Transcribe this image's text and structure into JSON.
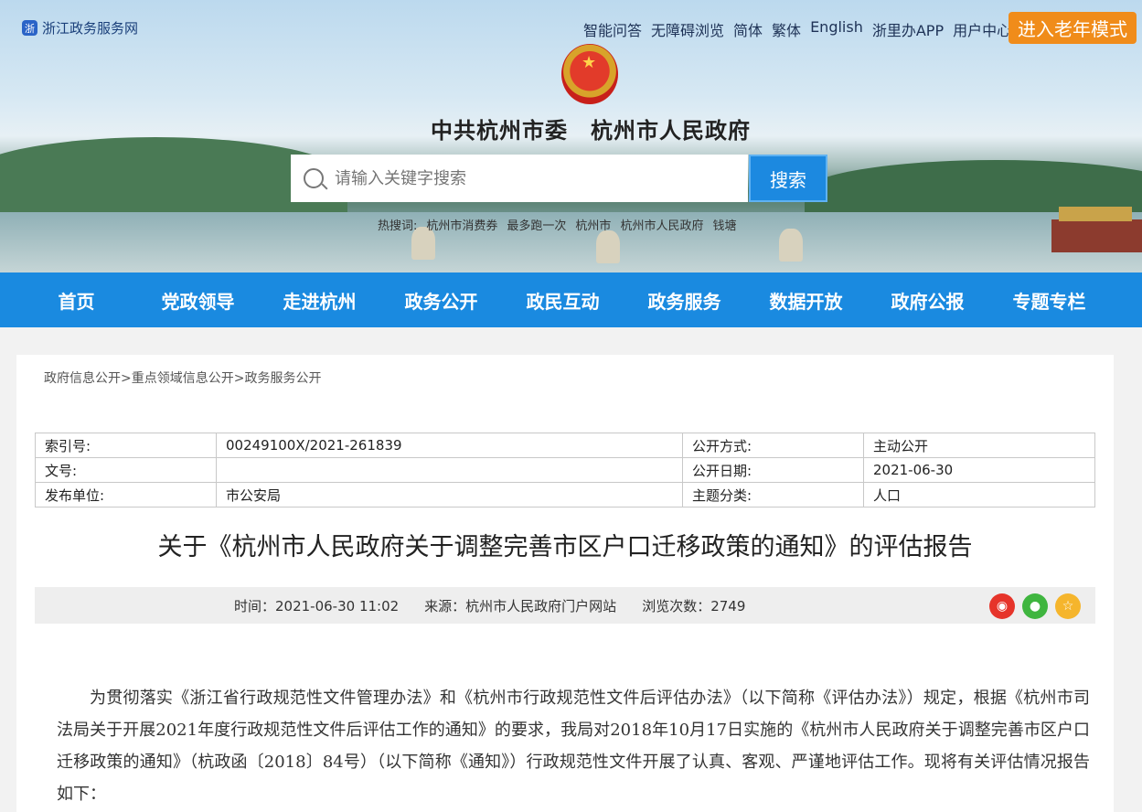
{
  "header": {
    "brand": "浙江政务服务网",
    "toplinks": [
      "智能问答",
      "无障碍浏览",
      "简体",
      "繁体",
      "English",
      "浙里办APP",
      "用户中心"
    ],
    "elder_mode": "进入老年模式",
    "site_title": "中共杭州市委　杭州市人民政府",
    "search": {
      "placeholder": "请输入关键字搜索",
      "button": "搜索"
    },
    "hotwords_label": "热搜词:",
    "hotwords": [
      "杭州市消费券",
      "最多跑一次",
      "杭州市",
      "杭州市人民政府",
      "钱塘"
    ]
  },
  "nav": [
    "首页",
    "党政领导",
    "走进杭州",
    "政务公开",
    "政民互动",
    "政务服务",
    "数据开放",
    "政府公报",
    "专题专栏"
  ],
  "breadcrumb": [
    "政府信息公开",
    ">",
    "重点领域信息公开",
    ">",
    "政务服务公开"
  ],
  "meta": {
    "rows": [
      [
        "索引号:",
        "00249100X/2021-261839",
        "公开方式:",
        "主动公开"
      ],
      [
        "文号:",
        "",
        "公开日期:",
        "2021-06-30"
      ],
      [
        "发布单位:",
        "市公安局",
        "主题分类:",
        "人口"
      ]
    ]
  },
  "article": {
    "title": "关于《杭州市人民政府关于调整完善市区户口迁移政策的通知》的评估报告",
    "time": "时间：2021-06-30 11:02",
    "source": "来源：杭州市人民政府门户网站",
    "views": "浏览次数：2749",
    "body": "为贯彻落实《浙江省行政规范性文件管理办法》和《杭州市行政规范性文件后评估办法》（以下简称《评估办法》）规定，根据《杭州市司法局关于开展2021年度行政规范性文件后评估工作的通知》的要求，我局对2018年10月17日实施的《杭州市人民政府关于调整完善市区户口迁移政策的通知》（杭政函〔2018〕84号）（以下简称《通知》）行政规范性文件开展了认真、客观、严谨地评估工作。现将有关评估情况报告如下："
  },
  "colors": {
    "nav": "#1a8ae0",
    "elder": "#f08c1a",
    "weibo": "#e6342a",
    "wechat": "#3fb53f",
    "favorite": "#f5b52c"
  }
}
